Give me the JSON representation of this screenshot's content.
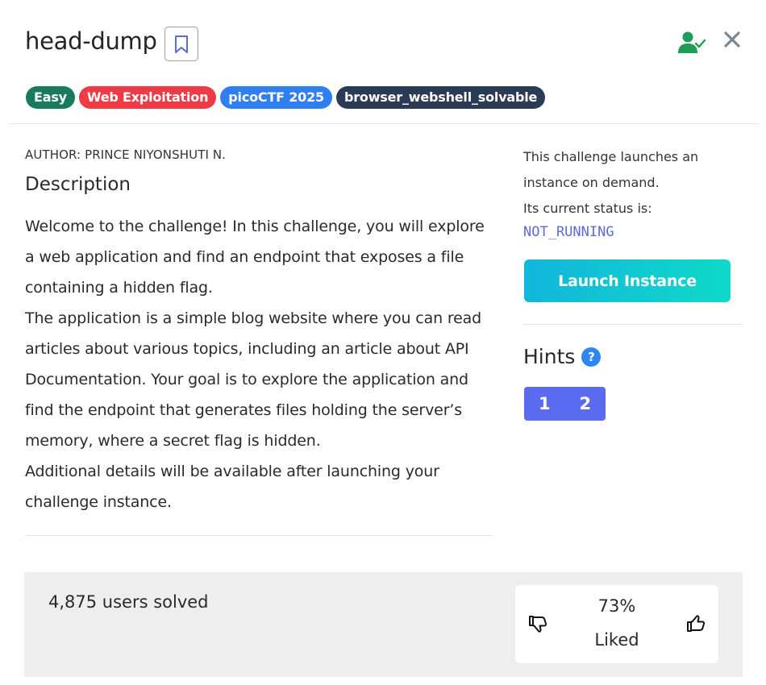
{
  "challenge": {
    "title": "head-dump",
    "tags": [
      {
        "label": "Easy",
        "color": "#1a7a5e"
      },
      {
        "label": "Web Exploitation",
        "color": "#ef3b45"
      },
      {
        "label": "picoCTF 2025",
        "color": "#2f7ff2"
      },
      {
        "label": "browser_webshell_solvable",
        "color": "#2b3a55"
      }
    ],
    "author": "AUTHOR: PRINCE NIYONSHUTI N.",
    "description_heading": "Description",
    "description": [
      "Welcome to the challenge! In this challenge, you will explore a web application and find an endpoint that exposes a file containing a hidden flag.",
      "The application is a simple blog website where you can read articles about various topics, including an article about API Documentation. Your goal is to explore the application and find the endpoint that generates files holding the server’s memory, where a secret flag is hidden.",
      "Additional details will be available after launching your challenge instance."
    ]
  },
  "instance": {
    "text_line1": "This challenge launches an instance on demand.",
    "text_line2": "Its current status is:",
    "status": "NOT_RUNNING",
    "launch_label": "Launch Instance"
  },
  "hints": {
    "heading": "Hints",
    "help_glyph": "?",
    "buttons": [
      "1",
      "2"
    ]
  },
  "stats": {
    "solved": "4,875 users solved",
    "liked_percent": "73%",
    "liked_label": "Liked"
  },
  "icons": {
    "bookmark": "bookmark-icon",
    "user_check": "user-check-icon",
    "close": "close-icon",
    "thumbs_down": "thumbs-down-icon",
    "thumbs_up": "thumbs-up-icon",
    "help": "question-circle-icon"
  },
  "colors": {
    "accent_green": "#1f9d55",
    "status_mono": "#5b6bdc",
    "hint_button": "#5b6bf0"
  }
}
